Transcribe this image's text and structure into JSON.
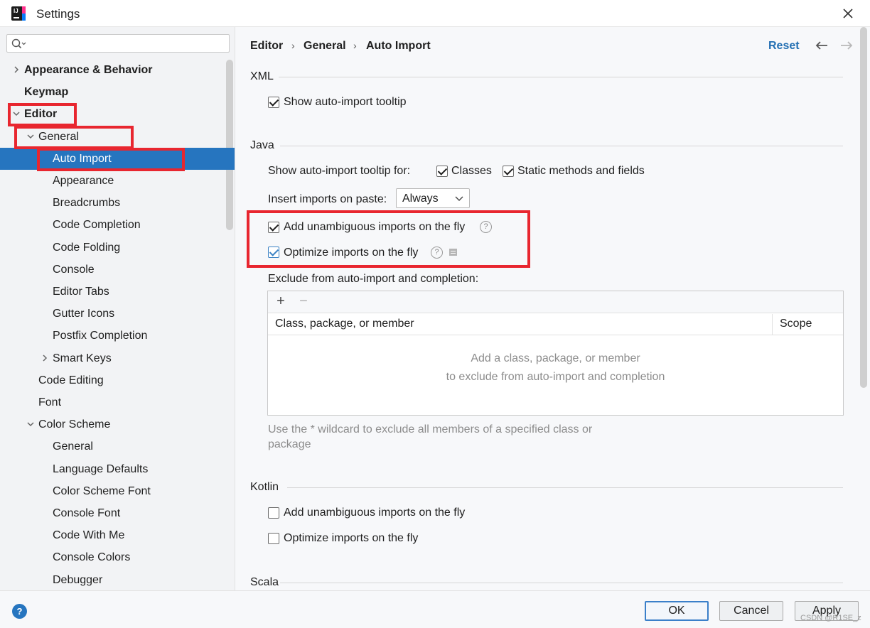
{
  "window": {
    "title": "Settings"
  },
  "search": {
    "placeholder": ""
  },
  "sidebar": {
    "items": [
      {
        "label": "Appearance & Behavior",
        "level": 0,
        "expanded": false,
        "has_children": true
      },
      {
        "label": "Keymap",
        "level": 0,
        "has_children": false
      },
      {
        "label": "Editor",
        "level": 0,
        "expanded": true,
        "has_children": true
      },
      {
        "label": "General",
        "level": 1,
        "expanded": true,
        "has_children": true
      },
      {
        "label": "Auto Import",
        "level": 2,
        "selected": true
      },
      {
        "label": "Appearance",
        "level": 2
      },
      {
        "label": "Breadcrumbs",
        "level": 2
      },
      {
        "label": "Code Completion",
        "level": 2
      },
      {
        "label": "Code Folding",
        "level": 2
      },
      {
        "label": "Console",
        "level": 2
      },
      {
        "label": "Editor Tabs",
        "level": 2
      },
      {
        "label": "Gutter Icons",
        "level": 2
      },
      {
        "label": "Postfix Completion",
        "level": 2
      },
      {
        "label": "Smart Keys",
        "level": 2,
        "expanded": false,
        "has_children": true
      },
      {
        "label": "Code Editing",
        "level": 1
      },
      {
        "label": "Font",
        "level": 1
      },
      {
        "label": "Color Scheme",
        "level": 1,
        "expanded": true,
        "has_children": true
      },
      {
        "label": "General",
        "level": 2
      },
      {
        "label": "Language Defaults",
        "level": 2
      },
      {
        "label": "Color Scheme Font",
        "level": 2
      },
      {
        "label": "Console Font",
        "level": 2
      },
      {
        "label": "Code With Me",
        "level": 2
      },
      {
        "label": "Console Colors",
        "level": 2
      },
      {
        "label": "Debugger",
        "level": 2
      }
    ]
  },
  "breadcrumb": {
    "items": [
      "Editor",
      "General",
      "Auto Import"
    ],
    "separator": "›"
  },
  "header": {
    "reset_label": "Reset"
  },
  "xml": {
    "title": "XML",
    "show_tooltip": {
      "label": "Show auto-import tooltip",
      "checked": true
    }
  },
  "java": {
    "title": "Java",
    "tooltip_for_label": "Show auto-import tooltip for:",
    "classes": {
      "label": "Classes",
      "checked": true
    },
    "static_methods": {
      "label": "Static methods and fields",
      "checked": true
    },
    "insert_on_paste_label": "Insert imports on paste:",
    "insert_on_paste_value": "Always",
    "add_unambiguous": {
      "label": "Add unambiguous imports on the fly",
      "checked": true
    },
    "optimize_imports": {
      "label": "Optimize imports on the fly",
      "checked": true
    },
    "help_glyph": "?",
    "exclude_label": "Exclude from auto-import and completion:",
    "toolbar": {
      "add": "+",
      "remove": "−"
    },
    "columns": [
      "Class, package, or member",
      "Scope"
    ],
    "empty_line1": "Add a class, package, or member",
    "empty_line2": "to exclude from auto-import and completion",
    "hint": "Use the * wildcard to exclude all members of a specified class or package"
  },
  "kotlin": {
    "title": "Kotlin",
    "add_unambiguous": {
      "label": "Add unambiguous imports on the fly",
      "checked": false
    },
    "optimize_imports": {
      "label": "Optimize imports on the fly",
      "checked": false
    }
  },
  "scala": {
    "title": "Scala"
  },
  "footer": {
    "help_glyph": "?",
    "ok_label": "OK",
    "cancel_label": "Cancel",
    "apply_label": "Apply",
    "watermark": "CSDN @R1SE_z"
  },
  "colors": {
    "selection": "#2675bf",
    "link": "#2470b3",
    "highlight": "#e8262f",
    "sidebar_bg": "#f2f3f5",
    "content_bg": "#f7f8fa"
  }
}
